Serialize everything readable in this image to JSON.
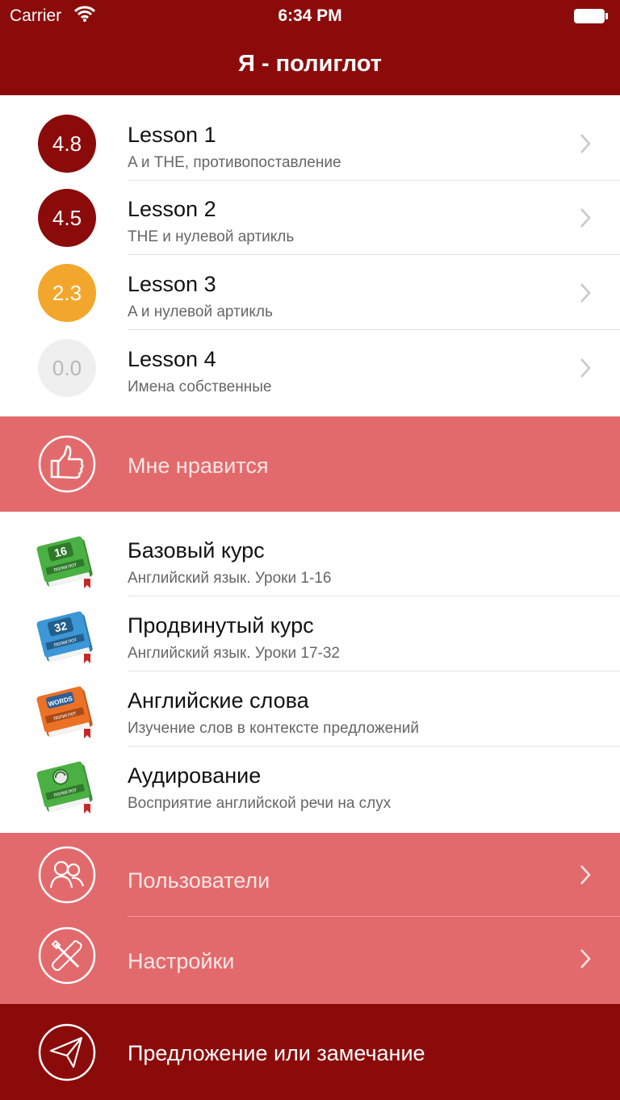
{
  "status": {
    "carrier": "Carrier",
    "time": "6:34 PM"
  },
  "nav": {
    "title": "Я - полиглот"
  },
  "lessons": [
    {
      "score": "4.8",
      "title": "Lesson 1",
      "subtitle": "A и THE, противопоставление",
      "color": "#8b0b0b"
    },
    {
      "score": "4.5",
      "title": "Lesson 2",
      "subtitle": "THE и нулевой артикль",
      "color": "#8b0b0b"
    },
    {
      "score": "2.3",
      "title": "Lesson 3",
      "subtitle": "A и нулевой артикль",
      "color": "#f2a72c"
    },
    {
      "score": "0.0",
      "title": "Lesson 4",
      "subtitle": "Имена собственные",
      "color": "#efefef"
    }
  ],
  "like": {
    "label": "Мне нравится",
    "icon": "thumbs-up-icon"
  },
  "courses": [
    {
      "title": "Базовый курс",
      "subtitle": "Английский язык. Уроки 1-16",
      "book_label": "16",
      "book_color": "#4bb043",
      "icon": "book-16-icon"
    },
    {
      "title": "Продвинутый курс",
      "subtitle": "Английский язык. Уроки 17-32",
      "book_label": "32",
      "book_color": "#3b97d6",
      "icon": "book-32-icon"
    },
    {
      "title": "Английские слова",
      "subtitle": "Изучение слов в контексте предложений",
      "book_label": "WORDS",
      "book_color": "#ec7126",
      "icon": "book-words-icon"
    },
    {
      "title": "Аудирование",
      "subtitle": "Восприятие английской речи на слух",
      "book_label": "",
      "book_color": "#4bb043",
      "icon": "book-audio-icon"
    }
  ],
  "book_brand": "полиглот",
  "menu": [
    {
      "label": "Пользователи",
      "icon": "users-icon"
    },
    {
      "label": "Настройки",
      "icon": "tools-icon"
    }
  ],
  "feedback": {
    "label": "Предложение или замечание",
    "icon": "paper-plane-icon"
  },
  "colors": {
    "primary": "#8b0b0b",
    "band": "#e36a6c",
    "gold": "#f2a72c"
  }
}
